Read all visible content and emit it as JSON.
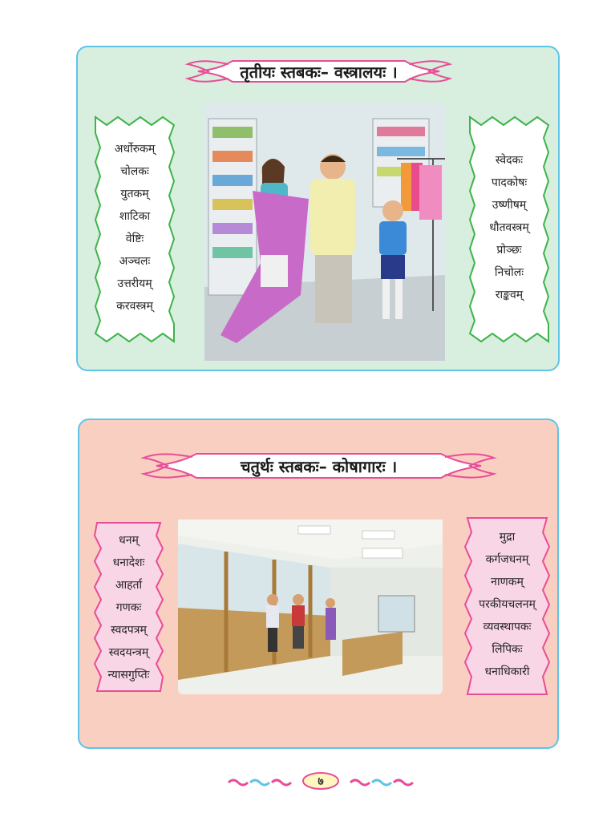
{
  "sections": [
    {
      "title": "तृतीयः स्तबकः– वस्त्रालयः ।",
      "left_words": [
        "अर्धोरुकम्",
        "चोलकः",
        "युतकम्",
        "शाटिका",
        "वेष्टिः",
        "अञ्चलः",
        "उत्तरीयम्",
        "करवस्त्रम्"
      ],
      "right_words": [
        "स्वेदकः",
        "पादकोषः",
        "उष्णीषम्",
        "धौतवस्त्रम्",
        "प्रोञ्छः",
        "निचोलः",
        "राङ्कवम्"
      ]
    },
    {
      "title": "चतुर्थः स्तबकः– कोषागारः ।",
      "left_words": [
        "धनम्",
        "धनादेशः",
        "आहर्ता",
        "गणकः",
        "स्वदपत्रम्",
        "स्वदयन्त्रम्",
        "न्यासगुप्तिः"
      ],
      "right_words": [
        "मुद्रा",
        "कर्गजधनम्",
        "नाणकम्",
        "परकीयचलनम्",
        "व्यवस्थापकः",
        "लिपिकः",
        "धनाधिकारी"
      ]
    }
  ],
  "page_number": "७",
  "colors": {
    "panel1_bg": "#d8eede",
    "panel2_bg": "#f9cfc2",
    "border_blue": "#5ec4e8",
    "banner_pink": "#e94c97",
    "card_green": "#3eb44a",
    "card_pink": "#e94c97"
  }
}
